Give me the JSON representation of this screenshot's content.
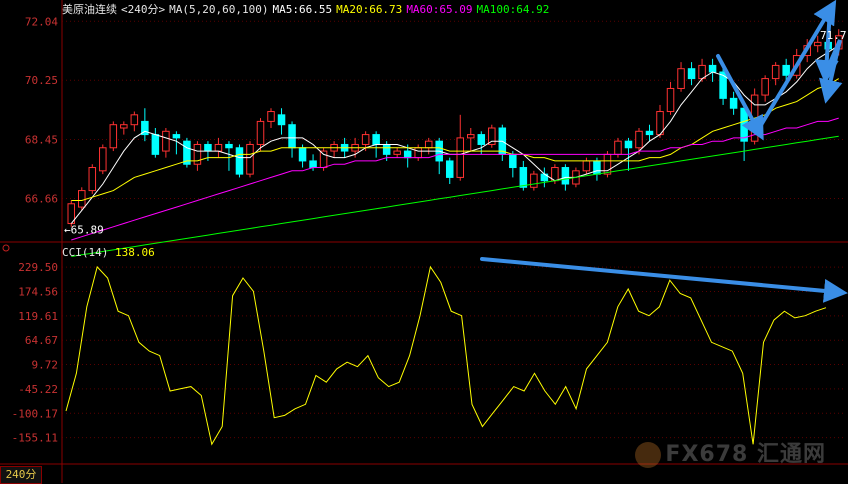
{
  "header": {
    "symbol": "美原油连续",
    "period": "<240分>",
    "ma_params": "MA(5,20,60,100)",
    "ma5": "MA5:66.55",
    "ma20": "MA20:66.73",
    "ma60": "MA60:65.09",
    "ma100": "MA100:64.92",
    "colors": {
      "ma5": "#ffffff",
      "ma20": "#ffff00",
      "ma60": "#ff00ff",
      "ma100": "#00ff00"
    }
  },
  "cci_header": {
    "label": "CCI(14)",
    "value": "138.06"
  },
  "timeframe_label": "240分",
  "watermark": "FX678 汇通网",
  "chart_data": [
    {
      "type": "candlestick",
      "title": "美原油连续 240分",
      "y_ticks": [
        "72.04",
        "70.25",
        "68.45",
        "66.66"
      ],
      "ylim": [
        65.4,
        72.2
      ],
      "low_label": "65.89",
      "high_label": "71.7",
      "candles": [
        [
          65.9,
          66.5,
          65.8,
          66.6
        ],
        [
          66.4,
          66.9,
          66.3,
          67.0
        ],
        [
          66.9,
          67.6,
          66.8,
          67.7
        ],
        [
          67.5,
          68.2,
          67.4,
          68.3
        ],
        [
          68.2,
          68.9,
          68.1,
          69.0
        ],
        [
          68.8,
          68.9,
          68.6,
          69.0
        ],
        [
          68.9,
          69.2,
          68.7,
          69.3
        ],
        [
          69.0,
          68.6,
          68.4,
          69.4
        ],
        [
          68.6,
          68.0,
          67.9,
          68.8
        ],
        [
          68.1,
          68.7,
          67.9,
          68.8
        ],
        [
          68.6,
          68.5,
          68.0,
          68.7
        ],
        [
          68.4,
          67.7,
          67.6,
          68.5
        ],
        [
          67.7,
          68.3,
          67.5,
          68.4
        ],
        [
          68.3,
          68.1,
          67.8,
          68.4
        ],
        [
          68.1,
          68.3,
          67.9,
          68.5
        ],
        [
          68.3,
          68.2,
          67.5,
          68.4
        ],
        [
          68.2,
          67.4,
          67.3,
          68.3
        ],
        [
          67.4,
          68.3,
          67.3,
          68.4
        ],
        [
          68.3,
          69.0,
          68.1,
          69.1
        ],
        [
          69.0,
          69.3,
          68.8,
          69.4
        ],
        [
          69.2,
          68.9,
          68.6,
          69.4
        ],
        [
          68.9,
          68.2,
          67.9,
          69.0
        ],
        [
          68.2,
          67.8,
          67.6,
          68.3
        ],
        [
          67.8,
          67.6,
          67.5,
          68.0
        ],
        [
          67.6,
          68.1,
          67.5,
          68.2
        ],
        [
          68.1,
          68.3,
          67.9,
          68.4
        ],
        [
          68.3,
          68.1,
          67.9,
          68.5
        ],
        [
          68.1,
          68.3,
          67.9,
          68.5
        ],
        [
          68.3,
          68.6,
          68.1,
          68.7
        ],
        [
          68.6,
          68.3,
          67.9,
          68.7
        ],
        [
          68.3,
          68.0,
          67.8,
          68.4
        ],
        [
          68.0,
          68.1,
          67.9,
          68.2
        ],
        [
          68.1,
          67.9,
          67.6,
          68.3
        ],
        [
          67.9,
          68.2,
          67.8,
          68.3
        ],
        [
          68.2,
          68.4,
          68.0,
          68.5
        ],
        [
          68.4,
          67.8,
          67.4,
          68.5
        ],
        [
          67.8,
          67.3,
          67.1,
          67.9
        ],
        [
          67.3,
          68.5,
          67.2,
          69.2
        ],
        [
          68.5,
          68.6,
          68.1,
          68.8
        ],
        [
          68.6,
          68.3,
          68.0,
          68.7
        ],
        [
          68.3,
          68.8,
          68.2,
          68.9
        ],
        [
          68.8,
          68.0,
          67.8,
          68.9
        ],
        [
          68.0,
          67.6,
          67.3,
          68.1
        ],
        [
          67.6,
          67.0,
          66.9,
          67.8
        ],
        [
          67.0,
          67.4,
          66.9,
          67.5
        ],
        [
          67.4,
          67.2,
          67.0,
          67.6
        ],
        [
          67.2,
          67.6,
          67.1,
          67.7
        ],
        [
          67.6,
          67.1,
          66.9,
          67.7
        ],
        [
          67.1,
          67.5,
          67.0,
          67.6
        ],
        [
          67.5,
          67.8,
          67.4,
          67.9
        ],
        [
          67.8,
          67.4,
          67.2,
          67.9
        ],
        [
          67.4,
          68.0,
          67.3,
          68.1
        ],
        [
          68.0,
          68.4,
          67.9,
          68.5
        ],
        [
          68.4,
          68.2,
          67.5,
          68.5
        ],
        [
          68.2,
          68.7,
          68.0,
          68.8
        ],
        [
          68.7,
          68.6,
          68.4,
          68.9
        ],
        [
          68.6,
          69.3,
          68.5,
          69.5
        ],
        [
          69.3,
          70.0,
          69.2,
          70.2
        ],
        [
          70.0,
          70.6,
          69.9,
          70.8
        ],
        [
          70.6,
          70.3,
          70.1,
          70.8
        ],
        [
          70.3,
          70.7,
          70.2,
          70.9
        ],
        [
          70.7,
          70.5,
          70.2,
          70.9
        ],
        [
          70.5,
          69.7,
          69.5,
          70.7
        ],
        [
          69.7,
          69.4,
          69.2,
          69.9
        ],
        [
          69.4,
          68.4,
          67.8,
          69.6
        ],
        [
          68.4,
          69.8,
          68.3,
          70.0
        ],
        [
          69.8,
          70.3,
          69.6,
          70.4
        ],
        [
          70.3,
          70.7,
          70.1,
          70.8
        ],
        [
          70.7,
          70.4,
          70.2,
          70.9
        ],
        [
          70.4,
          71.0,
          70.3,
          71.2
        ],
        [
          71.0,
          71.3,
          70.8,
          71.5
        ],
        [
          71.3,
          71.4,
          71.1,
          71.6
        ],
        [
          71.4,
          71.2,
          70.9,
          71.5
        ],
        [
          71.2,
          71.6,
          71.0,
          71.8
        ]
      ],
      "series": [
        {
          "name": "MA5",
          "color": "#ffffff",
          "values": [
            65.9,
            66.3,
            66.7,
            67.1,
            67.6,
            68.1,
            68.5,
            68.7,
            68.6,
            68.5,
            68.4,
            68.2,
            68.1,
            68.1,
            68.1,
            68.0,
            67.9,
            67.9,
            68.2,
            68.4,
            68.5,
            68.5,
            68.5,
            68.3,
            68.0,
            67.9,
            67.9,
            68.0,
            68.2,
            68.3,
            68.3,
            68.3,
            68.2,
            68.1,
            68.1,
            68.1,
            68.0,
            68.0,
            68.1,
            68.2,
            68.4,
            68.4,
            68.2,
            68.0,
            67.7,
            67.4,
            67.2,
            67.3,
            67.3,
            67.4,
            67.5,
            67.5,
            67.7,
            67.9,
            68.1,
            68.4,
            68.6,
            69.0,
            69.5,
            69.9,
            70.3,
            70.5,
            70.4,
            70.2,
            69.8,
            69.5,
            69.5,
            69.7,
            69.9,
            70.2,
            70.6,
            70.9,
            71.1,
            71.3
          ]
        },
        {
          "name": "MA20",
          "color": "#ffff00",
          "values": [
            66.6,
            66.6,
            66.7,
            66.8,
            66.9,
            67.1,
            67.3,
            67.4,
            67.5,
            67.6,
            67.7,
            67.8,
            67.8,
            67.9,
            67.9,
            67.9,
            68.0,
            68.0,
            68.1,
            68.1,
            68.2,
            68.2,
            68.2,
            68.2,
            68.2,
            68.2,
            68.2,
            68.2,
            68.2,
            68.2,
            68.2,
            68.2,
            68.2,
            68.2,
            68.2,
            68.2,
            68.1,
            68.1,
            68.1,
            68.1,
            68.1,
            68.1,
            68.0,
            68.0,
            67.9,
            67.9,
            67.8,
            67.8,
            67.8,
            67.8,
            67.8,
            67.8,
            67.8,
            67.8,
            67.8,
            67.9,
            67.9,
            68.0,
            68.2,
            68.3,
            68.5,
            68.7,
            68.8,
            68.9,
            69.0,
            69.1,
            69.2,
            69.4,
            69.5,
            69.6,
            69.8,
            70.0,
            70.1,
            70.3
          ]
        },
        {
          "name": "MA60",
          "color": "#ff00ff",
          "values": [
            65.4,
            65.5,
            65.6,
            65.7,
            65.8,
            65.9,
            66.0,
            66.1,
            66.2,
            66.3,
            66.4,
            66.5,
            66.6,
            66.7,
            66.8,
            66.9,
            67.0,
            67.1,
            67.2,
            67.3,
            67.4,
            67.5,
            67.5,
            67.6,
            67.6,
            67.7,
            67.7,
            67.8,
            67.8,
            67.8,
            67.9,
            67.9,
            67.9,
            67.9,
            67.9,
            68.0,
            68.0,
            68.0,
            68.0,
            68.0,
            68.0,
            68.0,
            68.0,
            68.0,
            68.0,
            68.0,
            68.0,
            68.0,
            68.0,
            68.0,
            68.0,
            68.0,
            68.0,
            68.0,
            68.1,
            68.1,
            68.1,
            68.2,
            68.2,
            68.3,
            68.3,
            68.4,
            68.4,
            68.5,
            68.5,
            68.6,
            68.6,
            68.7,
            68.8,
            68.8,
            68.9,
            69.0,
            69.0,
            69.1
          ]
        },
        {
          "name": "MA100",
          "color": "#00ff00",
          "values": [
            64.9,
            64.95,
            65.0,
            65.05,
            65.1,
            65.15,
            65.2,
            65.25,
            65.3,
            65.35,
            65.4,
            65.45,
            65.5,
            65.55,
            65.6,
            65.65,
            65.7,
            65.75,
            65.8,
            65.85,
            65.9,
            65.95,
            66.0,
            66.05,
            66.1,
            66.15,
            66.2,
            66.25,
            66.3,
            66.35,
            66.4,
            66.45,
            66.5,
            66.55,
            66.6,
            66.65,
            66.7,
            66.75,
            66.8,
            66.85,
            66.9,
            66.95,
            67.0,
            67.05,
            67.1,
            67.15,
            67.2,
            67.25,
            67.3,
            67.35,
            67.4,
            67.45,
            67.5,
            67.55,
            67.6,
            67.65,
            67.7,
            67.75,
            67.8,
            67.85,
            67.9,
            67.95,
            68.0,
            68.05,
            68.1,
            68.15,
            68.2,
            68.25,
            68.3,
            68.35,
            68.4,
            68.45,
            68.5,
            68.55
          ]
        }
      ]
    },
    {
      "type": "line",
      "title": "CCI(14)",
      "y_ticks": [
        "229.50",
        "174.56",
        "119.61",
        "64.67",
        "9.72",
        "-45.22",
        "-100.17",
        "-155.11"
      ],
      "ylim": [
        -210,
        250
      ],
      "series": [
        {
          "name": "CCI(14)",
          "color": "#ffff00",
          "values": [
            -95,
            -10,
            140,
            230,
            205,
            130,
            120,
            60,
            40,
            30,
            -50,
            -45,
            -40,
            -60,
            -170,
            -130,
            165,
            205,
            175,
            40,
            -110,
            -105,
            -90,
            -80,
            -15,
            -30,
            0,
            15,
            5,
            30,
            -20,
            -40,
            -30,
            30,
            120,
            230,
            195,
            130,
            120,
            -80,
            -130,
            -100,
            -70,
            -40,
            -50,
            -10,
            -50,
            -80,
            -40,
            -90,
            0,
            30,
            60,
            140,
            180,
            130,
            120,
            140,
            200,
            170,
            160,
            110,
            60,
            50,
            40,
            -10,
            -170,
            60,
            110,
            130,
            115,
            120,
            130,
            138
          ]
        }
      ]
    }
  ]
}
